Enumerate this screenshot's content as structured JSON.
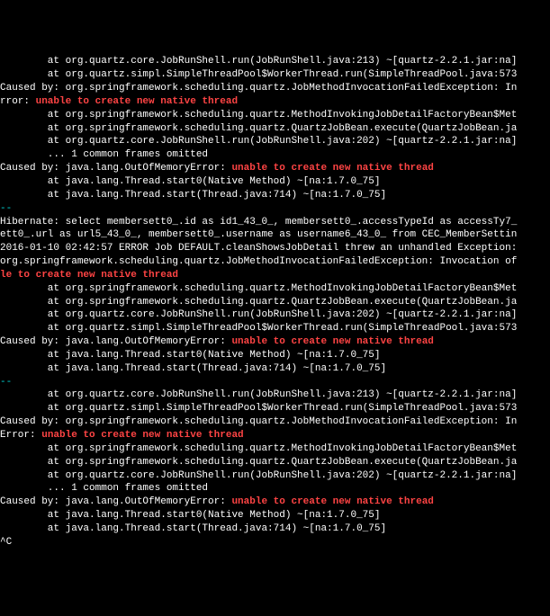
{
  "lines": [
    {
      "segments": [
        {
          "class": "white",
          "text": "        at org.quartz.core.JobRunShell.run(JobRunShell.java:213) ~[quartz-2.2.1.jar:na]"
        }
      ]
    },
    {
      "segments": [
        {
          "class": "white",
          "text": "        at org.quartz.simpl.SimpleThreadPool$WorkerThread.run(SimpleThreadPool.java:573"
        }
      ]
    },
    {
      "segments": [
        {
          "class": "white",
          "text": "Caused by: org.springframework.scheduling.quartz.JobMethodInvocationFailedException: In"
        }
      ]
    },
    {
      "segments": [
        {
          "class": "white",
          "text": "rror: "
        },
        {
          "class": "red",
          "text": "unable to create new native thread"
        }
      ]
    },
    {
      "segments": [
        {
          "class": "white",
          "text": "        at org.springframework.scheduling.quartz.MethodInvokingJobDetailFactoryBean$Met"
        }
      ]
    },
    {
      "segments": [
        {
          "class": "white",
          "text": "        at org.springframework.scheduling.quartz.QuartzJobBean.execute(QuartzJobBean.ja"
        }
      ]
    },
    {
      "segments": [
        {
          "class": "white",
          "text": "        at org.quartz.core.JobRunShell.run(JobRunShell.java:202) ~[quartz-2.2.1.jar:na]"
        }
      ]
    },
    {
      "segments": [
        {
          "class": "white",
          "text": "        ... 1 common frames omitted"
        }
      ]
    },
    {
      "segments": [
        {
          "class": "white",
          "text": "Caused by: java.lang.OutOfMemoryError: "
        },
        {
          "class": "red",
          "text": "unable to create new native thread"
        }
      ]
    },
    {
      "segments": [
        {
          "class": "white",
          "text": "        at java.lang.Thread.start0(Native Method) ~[na:1.7.0_75]"
        }
      ]
    },
    {
      "segments": [
        {
          "class": "white",
          "text": "        at java.lang.Thread.start(Thread.java:714) ~[na:1.7.0_75]"
        }
      ]
    },
    {
      "segments": [
        {
          "class": "cyan",
          "text": "--"
        }
      ]
    },
    {
      "segments": [
        {
          "class": "white",
          "text": "Hibernate: select membersett0_.id as id1_43_0_, membersett0_.accessTypeId as accessTy7_"
        }
      ]
    },
    {
      "segments": [
        {
          "class": "white",
          "text": "ett0_.url as url5_43_0_, membersett0_.username as username6_43_0_ from CEC_MemberSettin"
        }
      ]
    },
    {
      "segments": [
        {
          "class": "white",
          "text": "2016-01-10 02:42:57 ERROR Job DEFAULT.cleanShowsJobDetail threw an unhandled Exception:"
        }
      ]
    },
    {
      "segments": [
        {
          "class": "white",
          "text": "org.springframework.scheduling.quartz.JobMethodInvocationFailedException: Invocation of"
        }
      ]
    },
    {
      "segments": [
        {
          "class": "red",
          "text": "le to create new native thread"
        }
      ]
    },
    {
      "segments": [
        {
          "class": "white",
          "text": "        at org.springframework.scheduling.quartz.MethodInvokingJobDetailFactoryBean$Met"
        }
      ]
    },
    {
      "segments": [
        {
          "class": "white",
          "text": "        at org.springframework.scheduling.quartz.QuartzJobBean.execute(QuartzJobBean.ja"
        }
      ]
    },
    {
      "segments": [
        {
          "class": "white",
          "text": "        at org.quartz.core.JobRunShell.run(JobRunShell.java:202) ~[quartz-2.2.1.jar:na]"
        }
      ]
    },
    {
      "segments": [
        {
          "class": "white",
          "text": "        at org.quartz.simpl.SimpleThreadPool$WorkerThread.run(SimpleThreadPool.java:573"
        }
      ]
    },
    {
      "segments": [
        {
          "class": "white",
          "text": "Caused by: java.lang.OutOfMemoryError: "
        },
        {
          "class": "red",
          "text": "unable to create new native thread"
        }
      ]
    },
    {
      "segments": [
        {
          "class": "white",
          "text": "        at java.lang.Thread.start0(Native Method) ~[na:1.7.0_75]"
        }
      ]
    },
    {
      "segments": [
        {
          "class": "white",
          "text": "        at java.lang.Thread.start(Thread.java:714) ~[na:1.7.0_75]"
        }
      ]
    },
    {
      "segments": [
        {
          "class": "cyan",
          "text": "--"
        }
      ]
    },
    {
      "segments": [
        {
          "class": "white",
          "text": "        at org.quartz.core.JobRunShell.run(JobRunShell.java:213) ~[quartz-2.2.1.jar:na]"
        }
      ]
    },
    {
      "segments": [
        {
          "class": "white",
          "text": "        at org.quartz.simpl.SimpleThreadPool$WorkerThread.run(SimpleThreadPool.java:573"
        }
      ]
    },
    {
      "segments": [
        {
          "class": "white",
          "text": "Caused by: org.springframework.scheduling.quartz.JobMethodInvocationFailedException: In"
        }
      ]
    },
    {
      "segments": [
        {
          "class": "white",
          "text": "Error: "
        },
        {
          "class": "red",
          "text": "unable to create new native thread"
        }
      ]
    },
    {
      "segments": [
        {
          "class": "white",
          "text": "        at org.springframework.scheduling.quartz.MethodInvokingJobDetailFactoryBean$Met"
        }
      ]
    },
    {
      "segments": [
        {
          "class": "white",
          "text": "        at org.springframework.scheduling.quartz.QuartzJobBean.execute(QuartzJobBean.ja"
        }
      ]
    },
    {
      "segments": [
        {
          "class": "white",
          "text": "        at org.quartz.core.JobRunShell.run(JobRunShell.java:202) ~[quartz-2.2.1.jar:na]"
        }
      ]
    },
    {
      "segments": [
        {
          "class": "white",
          "text": "        ... 1 common frames omitted"
        }
      ]
    },
    {
      "segments": [
        {
          "class": "white",
          "text": "Caused by: java.lang.OutOfMemoryError: "
        },
        {
          "class": "red",
          "text": "unable to create new native thread"
        }
      ]
    },
    {
      "segments": [
        {
          "class": "white",
          "text": "        at java.lang.Thread.start0(Native Method) ~[na:1.7.0_75]"
        }
      ]
    },
    {
      "segments": [
        {
          "class": "white",
          "text": "        at java.lang.Thread.start(Thread.java:714) ~[na:1.7.0_75]"
        }
      ]
    },
    {
      "segments": [
        {
          "class": "white",
          "text": "^C"
        }
      ]
    }
  ]
}
